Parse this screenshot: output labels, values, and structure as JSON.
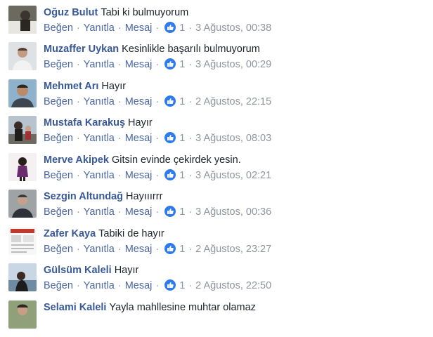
{
  "actions": {
    "like": "Beğen",
    "reply": "Yanıtla",
    "message": "Mesaj",
    "sep": "·"
  },
  "comments": [
    {
      "author": "Oğuz Bulut",
      "text": "Tabi ki bulmuyorum",
      "likes": "1",
      "time": "3 Ağustos, 00:38"
    },
    {
      "author": "Muzaffer Uykan",
      "text": "Kesinlikle başarılı bulmuyorum",
      "likes": "1",
      "time": "3 Ağustos, 00:29"
    },
    {
      "author": "Mehmet Arı",
      "text": "Hayır",
      "likes": "1",
      "time": "2 Ağustos, 22:15"
    },
    {
      "author": "Mustafa Karakuş",
      "text": "Hayır",
      "likes": "1",
      "time": "3 Ağustos, 08:03"
    },
    {
      "author": "Merve Akipek",
      "text": "Gitsin evinde çekirdek yesin.",
      "likes": "1",
      "time": "3 Ağustos, 02:21"
    },
    {
      "author": "Sezgin Altundağ",
      "text": "Hayııırrr",
      "likes": "1",
      "time": "3 Ağustos, 00:36"
    },
    {
      "author": "Zafer Kaya",
      "text": "Tabiki de hayır",
      "likes": "1",
      "time": "2 Ağustos, 23:27"
    },
    {
      "author": "Gülsüm Kaleli",
      "text": "Hayır",
      "likes": "1",
      "time": "2 Ağustos, 22:50"
    },
    {
      "author": "Selami Kaleli",
      "text": "Yayla mahllesine muhtar olamaz",
      "likes": "",
      "time": ""
    }
  ],
  "colors": {
    "author": "#385898",
    "link": "#4b67a1",
    "meta": "#90949c",
    "like": "#2e7bf0"
  }
}
